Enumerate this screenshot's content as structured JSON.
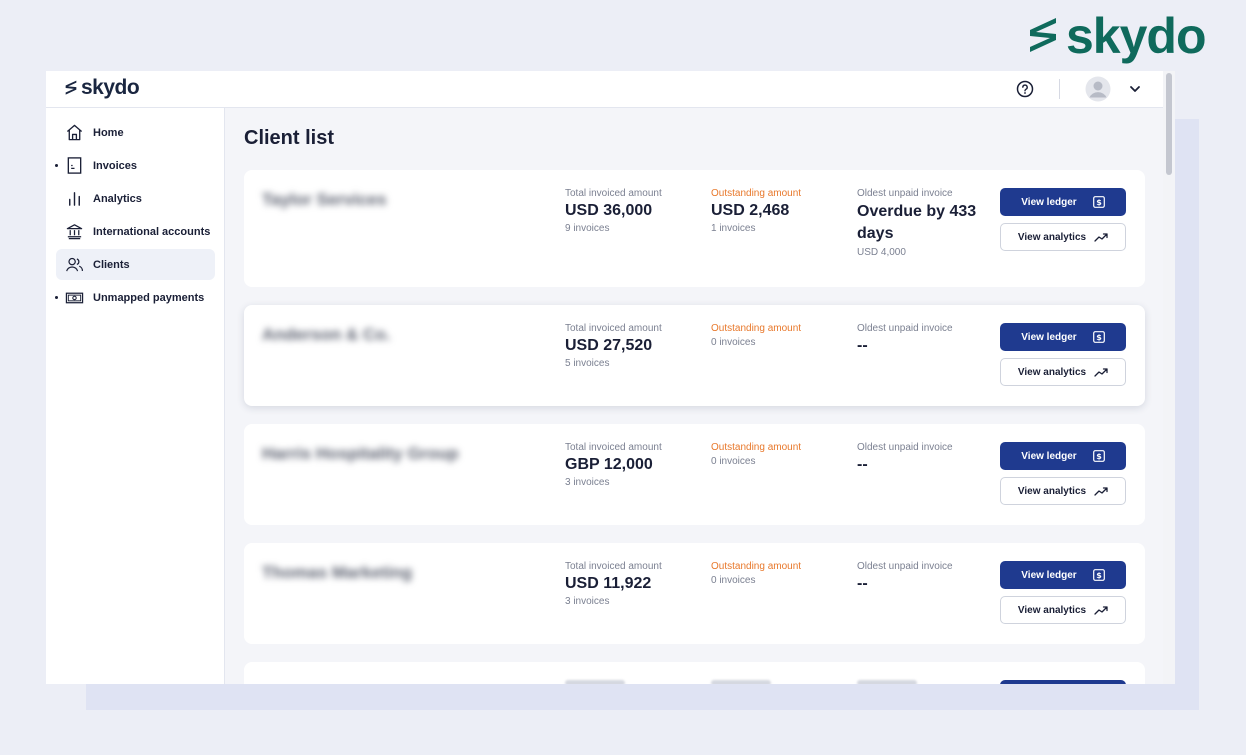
{
  "brand": {
    "name": "skydo",
    "mark_color": "#0f6a5c"
  },
  "topbar": {
    "logo": "skydo",
    "help_icon": "help-circle-icon",
    "avatar_icon": "user-avatar-icon",
    "menu_icon": "chevron-down-icon"
  },
  "sidebar": {
    "items": [
      {
        "label": "Home",
        "icon": "home-icon",
        "expandable": false,
        "active": false
      },
      {
        "label": "Invoices",
        "icon": "invoice-icon",
        "expandable": true,
        "active": false
      },
      {
        "label": "Analytics",
        "icon": "bar-chart-icon",
        "expandable": false,
        "active": false
      },
      {
        "label": "International accounts",
        "icon": "bank-icon",
        "expandable": false,
        "active": false
      },
      {
        "label": "Clients",
        "icon": "clients-icon",
        "expandable": false,
        "active": true
      },
      {
        "label": "Unmapped payments",
        "icon": "money-icon",
        "expandable": true,
        "active": false
      }
    ]
  },
  "main": {
    "title": "Client list",
    "columns": {
      "total": "Total invoiced amount",
      "outstanding": "Outstanding amount",
      "oldest": "Oldest unpaid invoice"
    },
    "buttons": {
      "ledger": "View ledger",
      "analytics": "View analytics"
    },
    "clients": [
      {
        "name": "Taylor Services",
        "total_amount": "USD 36,000",
        "total_invoices": "9 invoices",
        "outstanding_amount": "USD 2,468",
        "outstanding_invoices": "1 invoices",
        "oldest": "Overdue by 433 days",
        "oldest_sub": "USD 4,000"
      },
      {
        "name": "Anderson & Co.",
        "total_amount": "USD 27,520",
        "total_invoices": "5 invoices",
        "outstanding_amount": "",
        "outstanding_invoices": "0 invoices",
        "oldest": "--",
        "oldest_sub": ""
      },
      {
        "name": "Harris Hospitality Group",
        "total_amount": "GBP 12,000",
        "total_invoices": "3 invoices",
        "outstanding_amount": "",
        "outstanding_invoices": "0 invoices",
        "oldest": "--",
        "oldest_sub": ""
      },
      {
        "name": "Thomas Marketing",
        "total_amount": "USD 11,922",
        "total_invoices": "3 invoices",
        "outstanding_amount": "",
        "outstanding_invoices": "0 invoices",
        "oldest": "--",
        "oldest_sub": ""
      }
    ]
  },
  "colors": {
    "primary_button": "#1f3a8f",
    "outstanding_label": "#e8782b",
    "active_nav_bg": "#eef1f8"
  }
}
